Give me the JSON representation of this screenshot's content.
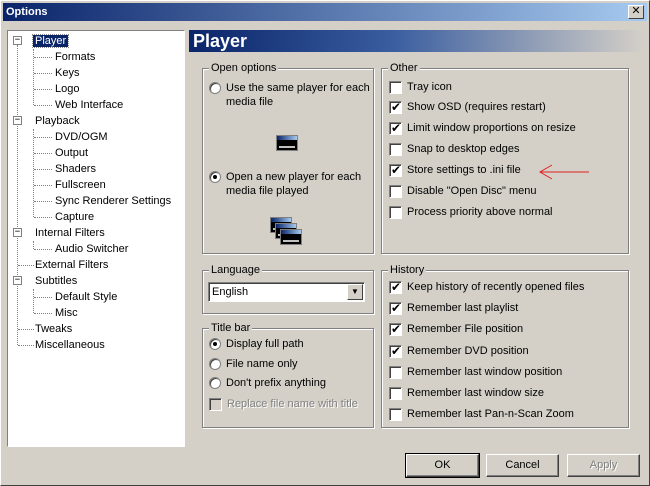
{
  "window": {
    "title": "Options",
    "close_symbol": "✕"
  },
  "tree": {
    "items": [
      {
        "label": "Player",
        "expander": "−"
      },
      {
        "label": "Formats"
      },
      {
        "label": "Keys"
      },
      {
        "label": "Logo"
      },
      {
        "label": "Web Interface"
      },
      {
        "label": "Playback",
        "expander": "−"
      },
      {
        "label": "DVD/OGM"
      },
      {
        "label": "Output"
      },
      {
        "label": "Shaders"
      },
      {
        "label": "Fullscreen"
      },
      {
        "label": "Sync Renderer Settings"
      },
      {
        "label": "Capture"
      },
      {
        "label": "Internal Filters",
        "expander": "−"
      },
      {
        "label": "Audio Switcher"
      },
      {
        "label": "External Filters"
      },
      {
        "label": "Subtitles",
        "expander": "−"
      },
      {
        "label": "Default Style"
      },
      {
        "label": "Misc"
      },
      {
        "label": "Tweaks"
      },
      {
        "label": "Miscellaneous"
      }
    ]
  },
  "page": {
    "title": "Player"
  },
  "open_options": {
    "title": "Open options",
    "same_player": "Use the same player for each media file",
    "new_player": "Open a new player for each media file played",
    "same_player_selected": false,
    "new_player_selected": true
  },
  "other": {
    "title": "Other",
    "items": [
      {
        "label": "Tray icon",
        "checked": false
      },
      {
        "label": "Show OSD (requires restart)",
        "checked": true
      },
      {
        "label": "Limit window proportions on resize",
        "checked": true
      },
      {
        "label": "Snap to desktop edges",
        "checked": false
      },
      {
        "label": "Store settings to .ini file",
        "checked": true
      },
      {
        "label": "Disable \"Open Disc\" menu",
        "checked": false
      },
      {
        "label": "Process priority above normal",
        "checked": false
      }
    ]
  },
  "language": {
    "title": "Language",
    "selected": "English"
  },
  "title_bar": {
    "title": "Title bar",
    "full_path": "Display full path",
    "file_name_only": "File name only",
    "dont_prefix": "Don't prefix anything",
    "replace_with_title": "Replace file name with title"
  },
  "history": {
    "title": "History",
    "items": [
      {
        "label": "Keep history of recently opened files",
        "checked": true
      },
      {
        "label": "Remember last playlist",
        "checked": true
      },
      {
        "label": "Remember File position",
        "checked": true
      },
      {
        "label": "Remember DVD position",
        "checked": true
      },
      {
        "label": "Remember last window position",
        "checked": false
      },
      {
        "label": "Remember last window size",
        "checked": false
      },
      {
        "label": "Remember last Pan-n-Scan Zoom",
        "checked": false
      }
    ]
  },
  "buttons": {
    "ok": "OK",
    "cancel": "Cancel",
    "apply": "Apply"
  },
  "marks": {
    "check": "✔",
    "dropdown": "▼"
  },
  "colors": {
    "annotation_arrow": "#e02020",
    "selection": "#0a246a"
  }
}
